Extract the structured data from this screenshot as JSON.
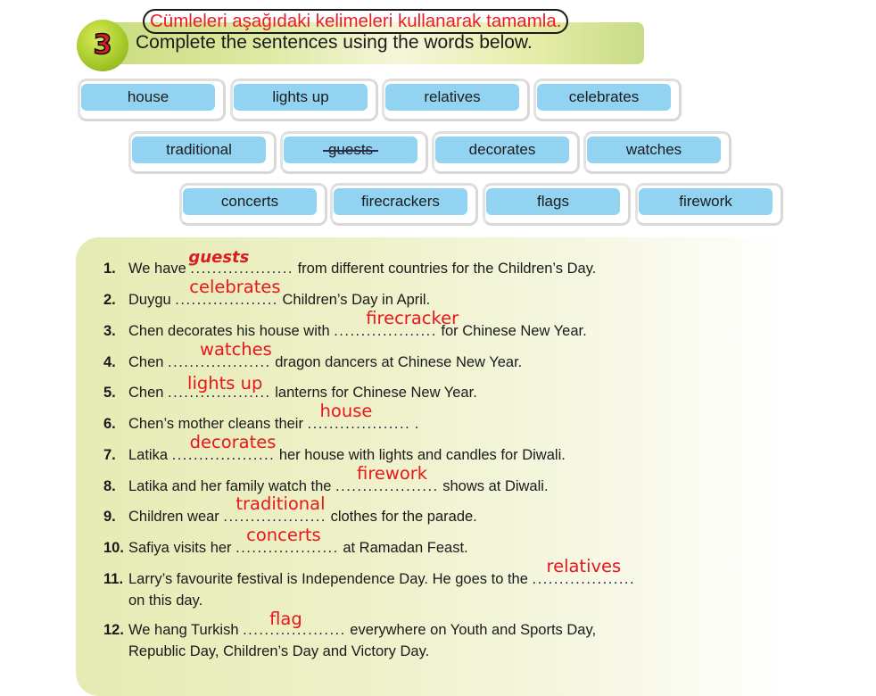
{
  "exercise": {
    "number": "3",
    "title_tr": "Cümleleri aşağıdaki kelimeleri kullanarak tamamla.",
    "title_en": "Complete the sentences using the words below."
  },
  "word_bank": [
    {
      "word": "house",
      "crossed_out": false
    },
    {
      "word": "lights up",
      "crossed_out": false
    },
    {
      "word": "relatives",
      "crossed_out": false
    },
    {
      "word": "celebrates",
      "crossed_out": false
    },
    {
      "word": "traditional",
      "crossed_out": false
    },
    {
      "word": "guests",
      "crossed_out": true
    },
    {
      "word": "decorates",
      "crossed_out": false
    },
    {
      "word": "watches",
      "crossed_out": false
    },
    {
      "word": "concerts",
      "crossed_out": false
    },
    {
      "word": "firecrackers",
      "crossed_out": false
    },
    {
      "word": "flags",
      "crossed_out": false
    },
    {
      "word": "firework",
      "crossed_out": false
    }
  ],
  "sentences": [
    {
      "num": "1.",
      "before": "We have ",
      "blank": "...................",
      "answer": "guests",
      "after": " from different countries for the Children’s Day."
    },
    {
      "num": "2.",
      "before": "Duygu ",
      "blank": "...................",
      "answer": "celebrates",
      "after": " Children’s Day in April."
    },
    {
      "num": "3.",
      "before": "Chen decorates his house with ",
      "blank": "...................",
      "answer": "firecracker",
      "after": " for Chinese New Year."
    },
    {
      "num": "4.",
      "before": "Chen ",
      "blank": "...................",
      "answer": "watches",
      "after": " dragon dancers at Chinese New Year."
    },
    {
      "num": "5.",
      "before": "Chen ",
      "blank": "...................",
      "answer": "lights up",
      "after": " lanterns for Chinese New Year."
    },
    {
      "num": "6.",
      "before": "Chen’s mother cleans their ",
      "blank": "...................",
      "answer": "house",
      "after": " ."
    },
    {
      "num": "7.",
      "before": "Latika ",
      "blank": "...................",
      "answer": "decorates",
      "after": " her house with lights and candles for Diwali."
    },
    {
      "num": "8.",
      "before": "Latika and her family watch the ",
      "blank": "...................",
      "answer": "firework",
      "after": " shows at Diwali."
    },
    {
      "num": "9.",
      "before": "Children wear ",
      "blank": "...................",
      "answer": "traditional",
      "after": " clothes for the parade."
    },
    {
      "num": "10.",
      "before": "Safiya visits her ",
      "blank": "...................",
      "answer": "concerts",
      "after": " at Ramadan Feast."
    },
    {
      "num": "11.",
      "before": "Larry’s favourite festival is Independence Day. He goes to the ",
      "blank": "...................",
      "answer": "relatives",
      "after": "",
      "continuation": "on this day."
    },
    {
      "num": "12.",
      "before": "We hang Turkish ",
      "blank": "...................",
      "answer": "flag",
      "after": "  everywhere  on Youth and Sports Day,",
      "continuation": "Republic Day, Children’s Day and Victory Day."
    }
  ],
  "colors": {
    "answer_red": "#e8161d",
    "chip_blue": "#92d3f2",
    "header_green": "#c9dd7e",
    "badge_green": "#a8cb2c"
  }
}
